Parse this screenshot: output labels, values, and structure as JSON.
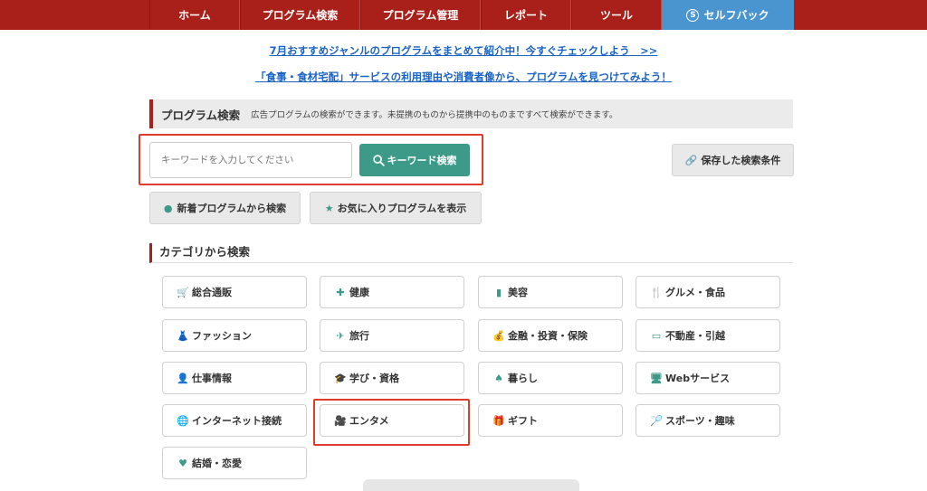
{
  "nav": {
    "home": "ホーム",
    "program_search": "プログラム検索",
    "program_manage": "プログラム管理",
    "report": "レポート",
    "tools": "ツール",
    "selfback": "セルフバック",
    "selfback_icon": "S"
  },
  "promos": {
    "line1": "7月おすすめジャンルのプログラムをまとめて紹介中！今すぐチェックしよう　>>",
    "line2": "「食事・食材宅配」サービスの利用理由や消費者像から、プログラムを見つけてみよう！"
  },
  "search": {
    "title": "プログラム検索",
    "description": "広告プログラムの検索ができます。未提携のものから提携中のものまですべて検索ができます。",
    "placeholder": "キーワードを入力してください",
    "button": "キーワード検索",
    "saved_conditions": "保存した検索条件",
    "new_programs": "新着プログラムから検索",
    "favorites": "お気に入りプログラムを表示"
  },
  "categories": {
    "heading": "カテゴリから検索",
    "items": [
      {
        "label": "総合通販",
        "icon": "cart-icon",
        "glyph": "🛒"
      },
      {
        "label": "健康",
        "icon": "first-aid-icon",
        "glyph": "✚"
      },
      {
        "label": "美容",
        "icon": "cosmetics-icon",
        "glyph": "▮"
      },
      {
        "label": "グルメ・食品",
        "icon": "cutlery-icon",
        "glyph": "🍴"
      },
      {
        "label": "ファッション",
        "icon": "dress-icon",
        "glyph": "👗"
      },
      {
        "label": "旅行",
        "icon": "airplane-icon",
        "glyph": "✈"
      },
      {
        "label": "金融・投資・保険",
        "icon": "money-bag-icon",
        "glyph": "💰"
      },
      {
        "label": "不動産・引越",
        "icon": "house-icon",
        "glyph": "▭"
      },
      {
        "label": "仕事情報",
        "icon": "person-icon",
        "glyph": "👤"
      },
      {
        "label": "学び・資格",
        "icon": "graduation-cap-icon",
        "glyph": "🎓"
      },
      {
        "label": "暮らし",
        "icon": "tree-icon",
        "glyph": "♠"
      },
      {
        "label": "Webサービス",
        "icon": "monitor-icon",
        "glyph": "🖥"
      },
      {
        "label": "インターネット接続",
        "icon": "globe-icon",
        "glyph": "🌐"
      },
      {
        "label": "エンタメ",
        "icon": "film-camera-icon",
        "glyph": "🎥"
      },
      {
        "label": "ギフト",
        "icon": "gift-icon",
        "glyph": "🎁"
      },
      {
        "label": "スポーツ・趣味",
        "icon": "racket-icon",
        "glyph": "🏸"
      },
      {
        "label": "結婚・恋愛",
        "icon": "heart-icon",
        "glyph": "♥"
      }
    ]
  },
  "colors": {
    "nav_bg": "#a9201a",
    "nav_active": "#4a95cf",
    "accent_green": "#3e9a88",
    "highlight_red": "#e03c2c",
    "link_blue": "#1a63c7"
  }
}
